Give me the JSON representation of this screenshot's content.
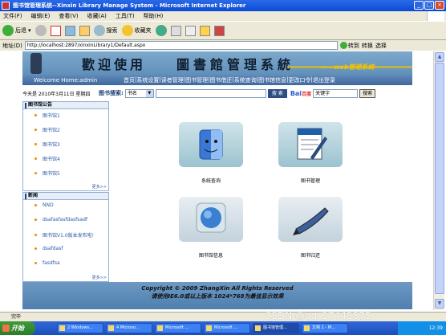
{
  "window": {
    "title": "图书馆管理系统--Xinxin Library Manage System - Microsoft Internet Explorer"
  },
  "menu": [
    "文件(F)",
    "编辑(E)",
    "查看(V)",
    "收藏(A)",
    "工具(T)",
    "帮助(H)"
  ],
  "toolbar": {
    "back": "后退",
    "search": "搜索",
    "favorites": "收藏夹"
  },
  "address": {
    "label": "地址(D)",
    "url": "http://localhost:2897/xinxinLibrary1/Default.aspx",
    "go": "转到",
    "links": "转换",
    "select": "选择"
  },
  "banner": {
    "welcome": "歡迎使用",
    "system": "圖書館管理系統",
    "sub": "——web管理系统"
  },
  "nav": {
    "welcome": "Welcome Home:admin",
    "links": [
      "首页",
      "系统设置",
      "读者管理",
      "图书管理",
      "图书借还",
      "系统查询",
      "图书馆信息",
      "更改口令",
      "退出登录"
    ]
  },
  "search": {
    "date": "今天是 2010年3月11日 星期四",
    "label": "图书搜索:",
    "select_value": "书名",
    "button": "搜 索",
    "baidu_value": "关键字",
    "baidu_button": "搜索"
  },
  "announcement": {
    "title": "图书馆公告",
    "items": [
      "图书馆1",
      "图书馆2",
      "图书馆3",
      "图书馆4",
      "图书馆5"
    ],
    "more": "更多>>"
  },
  "news": {
    "title": "新闻",
    "items": [
      "NND",
      "dsafasfasfdasfsadf",
      "图书馆V1.0版本发布啦!",
      "dsafdasf",
      "fasdfsa"
    ],
    "more": "更多>>"
  },
  "tiles": [
    {
      "caption": "系统查询"
    },
    {
      "caption": "图书管理"
    },
    {
      "caption": "图书馆信息"
    },
    {
      "caption": "图书归还"
    }
  ],
  "footer": {
    "line1": "Copyright © 2009 ZhangXin    All Rights Reserved",
    "line2": "请使用IE6.0或以上版本  1024*768为最佳显示效果"
  },
  "statusbar": "完毕",
  "taskbar": {
    "start": "开始",
    "items": [
      "2 Windows...",
      "4 Microso...",
      "Microsoft ...",
      "Microsoft ...",
      "图书馆管理...",
      "文档 1 - M..."
    ],
    "clock": "12:39"
  },
  "watermark": "CSDN @qq_17448875"
}
